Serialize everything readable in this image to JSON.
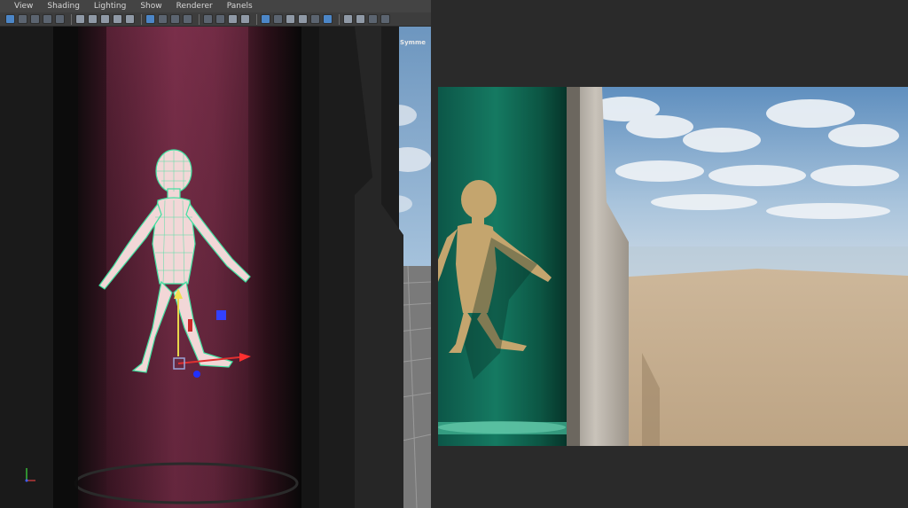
{
  "menubar": {
    "items": [
      "View",
      "Shading",
      "Lighting",
      "Show",
      "Renderer",
      "Panels"
    ]
  },
  "viewport": {
    "symmetry_label": "Symme"
  },
  "colors": {
    "accent_blue": "#4c86c7",
    "tube_pink": "#7a2f4a",
    "wireframe_green": "#40e0a0",
    "sky_blue": "#8fb7d8",
    "sand": "#c7b193",
    "tube_teal": "#127a62"
  },
  "icons": [
    "camera-icon",
    "grid-icon",
    "wireframe-icon",
    "shaded-icon",
    "light-icon",
    "isolate-icon"
  ]
}
